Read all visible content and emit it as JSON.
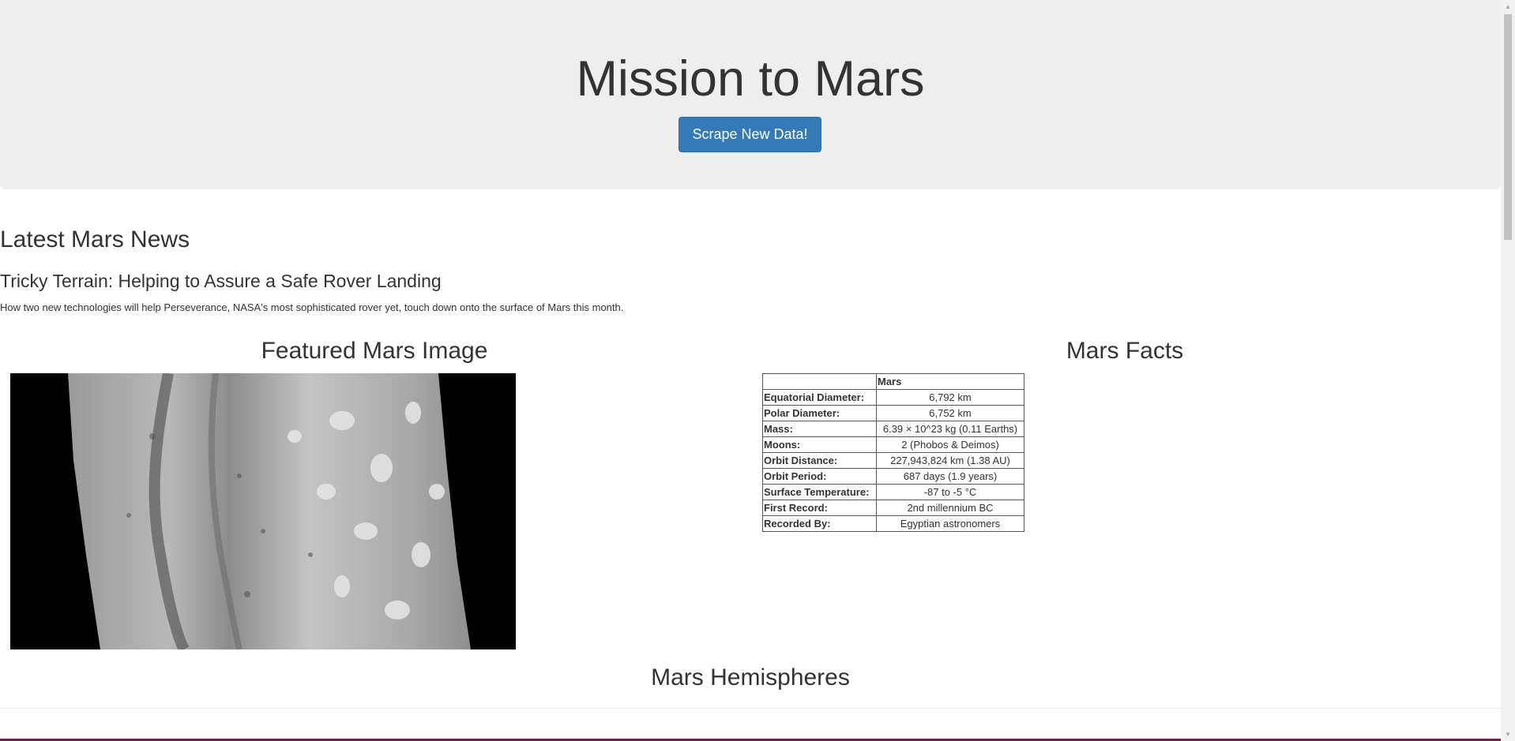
{
  "header": {
    "title": "Mission to Mars",
    "scrape_button": "Scrape New Data!"
  },
  "news": {
    "heading": "Latest Mars News",
    "title": "Tricky Terrain: Helping to Assure a Safe Rover Landing",
    "paragraph": "How two new technologies will help Perseverance, NASA's most sophisticated rover yet, touch down onto the surface of Mars this month."
  },
  "featured_image": {
    "heading": "Featured Mars Image"
  },
  "facts": {
    "heading": "Mars Facts",
    "column_header": "Mars",
    "rows": [
      {
        "label": "Equatorial Diameter:",
        "value": "6,792 km"
      },
      {
        "label": "Polar Diameter:",
        "value": "6,752 km"
      },
      {
        "label": "Mass:",
        "value": "6.39 × 10^23 kg (0.11 Earths)"
      },
      {
        "label": "Moons:",
        "value": "2 (Phobos & Deimos)"
      },
      {
        "label": "Orbit Distance:",
        "value": "227,943,824 km (1.38 AU)"
      },
      {
        "label": "Orbit Period:",
        "value": "687 days (1.9 years)"
      },
      {
        "label": "Surface Temperature:",
        "value": "-87 to -5 °C"
      },
      {
        "label": "First Record:",
        "value": "2nd millennium BC"
      },
      {
        "label": "Recorded By:",
        "value": "Egyptian astronomers"
      }
    ]
  },
  "hemispheres": {
    "heading": "Mars Hemispheres"
  },
  "colors": {
    "jumbotron_bg": "#eeeeee",
    "button_primary": "#337ab7",
    "text": "#333333"
  }
}
